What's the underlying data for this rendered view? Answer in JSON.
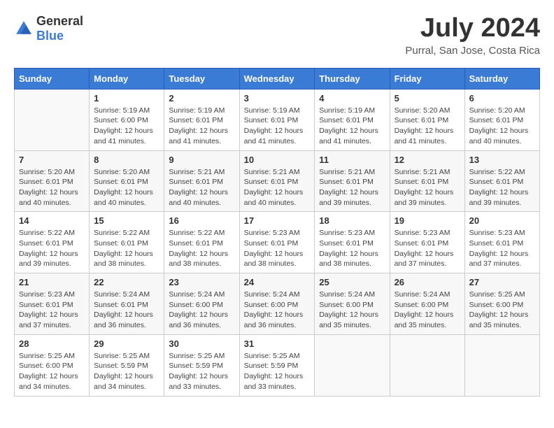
{
  "header": {
    "logo_general": "General",
    "logo_blue": "Blue",
    "title": "July 2024",
    "subtitle": "Purral, San Jose, Costa Rica"
  },
  "calendar": {
    "days_of_week": [
      "Sunday",
      "Monday",
      "Tuesday",
      "Wednesday",
      "Thursday",
      "Friday",
      "Saturday"
    ],
    "weeks": [
      [
        {
          "day": "",
          "info": ""
        },
        {
          "day": "1",
          "info": "Sunrise: 5:19 AM\nSunset: 6:00 PM\nDaylight: 12 hours\nand 41 minutes."
        },
        {
          "day": "2",
          "info": "Sunrise: 5:19 AM\nSunset: 6:01 PM\nDaylight: 12 hours\nand 41 minutes."
        },
        {
          "day": "3",
          "info": "Sunrise: 5:19 AM\nSunset: 6:01 PM\nDaylight: 12 hours\nand 41 minutes."
        },
        {
          "day": "4",
          "info": "Sunrise: 5:19 AM\nSunset: 6:01 PM\nDaylight: 12 hours\nand 41 minutes."
        },
        {
          "day": "5",
          "info": "Sunrise: 5:20 AM\nSunset: 6:01 PM\nDaylight: 12 hours\nand 41 minutes."
        },
        {
          "day": "6",
          "info": "Sunrise: 5:20 AM\nSunset: 6:01 PM\nDaylight: 12 hours\nand 40 minutes."
        }
      ],
      [
        {
          "day": "7",
          "info": "Sunrise: 5:20 AM\nSunset: 6:01 PM\nDaylight: 12 hours\nand 40 minutes."
        },
        {
          "day": "8",
          "info": "Sunrise: 5:20 AM\nSunset: 6:01 PM\nDaylight: 12 hours\nand 40 minutes."
        },
        {
          "day": "9",
          "info": "Sunrise: 5:21 AM\nSunset: 6:01 PM\nDaylight: 12 hours\nand 40 minutes."
        },
        {
          "day": "10",
          "info": "Sunrise: 5:21 AM\nSunset: 6:01 PM\nDaylight: 12 hours\nand 40 minutes."
        },
        {
          "day": "11",
          "info": "Sunrise: 5:21 AM\nSunset: 6:01 PM\nDaylight: 12 hours\nand 39 minutes."
        },
        {
          "day": "12",
          "info": "Sunrise: 5:21 AM\nSunset: 6:01 PM\nDaylight: 12 hours\nand 39 minutes."
        },
        {
          "day": "13",
          "info": "Sunrise: 5:22 AM\nSunset: 6:01 PM\nDaylight: 12 hours\nand 39 minutes."
        }
      ],
      [
        {
          "day": "14",
          "info": "Sunrise: 5:22 AM\nSunset: 6:01 PM\nDaylight: 12 hours\nand 39 minutes."
        },
        {
          "day": "15",
          "info": "Sunrise: 5:22 AM\nSunset: 6:01 PM\nDaylight: 12 hours\nand 38 minutes."
        },
        {
          "day": "16",
          "info": "Sunrise: 5:22 AM\nSunset: 6:01 PM\nDaylight: 12 hours\nand 38 minutes."
        },
        {
          "day": "17",
          "info": "Sunrise: 5:23 AM\nSunset: 6:01 PM\nDaylight: 12 hours\nand 38 minutes."
        },
        {
          "day": "18",
          "info": "Sunrise: 5:23 AM\nSunset: 6:01 PM\nDaylight: 12 hours\nand 38 minutes."
        },
        {
          "day": "19",
          "info": "Sunrise: 5:23 AM\nSunset: 6:01 PM\nDaylight: 12 hours\nand 37 minutes."
        },
        {
          "day": "20",
          "info": "Sunrise: 5:23 AM\nSunset: 6:01 PM\nDaylight: 12 hours\nand 37 minutes."
        }
      ],
      [
        {
          "day": "21",
          "info": "Sunrise: 5:23 AM\nSunset: 6:01 PM\nDaylight: 12 hours\nand 37 minutes."
        },
        {
          "day": "22",
          "info": "Sunrise: 5:24 AM\nSunset: 6:01 PM\nDaylight: 12 hours\nand 36 minutes."
        },
        {
          "day": "23",
          "info": "Sunrise: 5:24 AM\nSunset: 6:00 PM\nDaylight: 12 hours\nand 36 minutes."
        },
        {
          "day": "24",
          "info": "Sunrise: 5:24 AM\nSunset: 6:00 PM\nDaylight: 12 hours\nand 36 minutes."
        },
        {
          "day": "25",
          "info": "Sunrise: 5:24 AM\nSunset: 6:00 PM\nDaylight: 12 hours\nand 35 minutes."
        },
        {
          "day": "26",
          "info": "Sunrise: 5:24 AM\nSunset: 6:00 PM\nDaylight: 12 hours\nand 35 minutes."
        },
        {
          "day": "27",
          "info": "Sunrise: 5:25 AM\nSunset: 6:00 PM\nDaylight: 12 hours\nand 35 minutes."
        }
      ],
      [
        {
          "day": "28",
          "info": "Sunrise: 5:25 AM\nSunset: 6:00 PM\nDaylight: 12 hours\nand 34 minutes."
        },
        {
          "day": "29",
          "info": "Sunrise: 5:25 AM\nSunset: 5:59 PM\nDaylight: 12 hours\nand 34 minutes."
        },
        {
          "day": "30",
          "info": "Sunrise: 5:25 AM\nSunset: 5:59 PM\nDaylight: 12 hours\nand 33 minutes."
        },
        {
          "day": "31",
          "info": "Sunrise: 5:25 AM\nSunset: 5:59 PM\nDaylight: 12 hours\nand 33 minutes."
        },
        {
          "day": "",
          "info": ""
        },
        {
          "day": "",
          "info": ""
        },
        {
          "day": "",
          "info": ""
        }
      ]
    ]
  }
}
